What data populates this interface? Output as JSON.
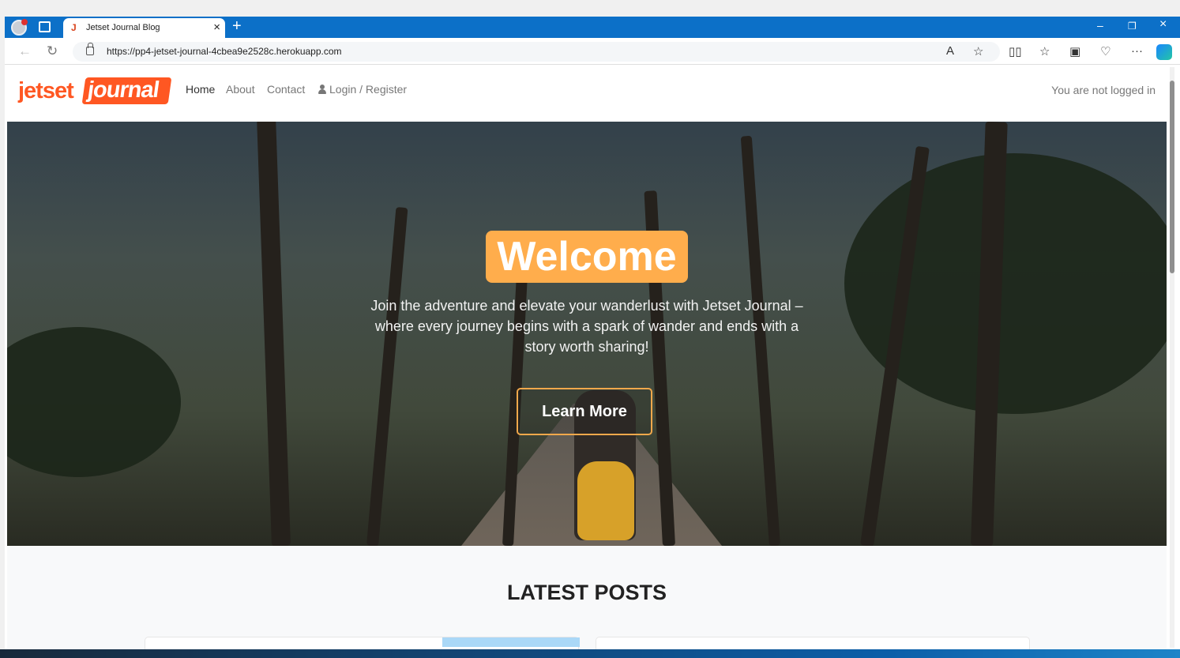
{
  "browser": {
    "tab_title": "Jetset Journal Blog",
    "tab_favicon": "J",
    "url": "https://pp4-jetset-journal-4cbea9e2528c.herokuapp.com",
    "new_tab": "+",
    "close_tab": "×",
    "minimize": "–",
    "restore": "❐",
    "close_window": "×",
    "back": "←",
    "refresh": "↻",
    "read_aloud": "A",
    "favorite": "☆",
    "split_screen": "▯▯",
    "favorites": "☆",
    "collections": "▣",
    "extensions": "♡",
    "more": "···"
  },
  "site": {
    "logo_jetset": "jetset",
    "logo_journal": "journal",
    "nav": {
      "home": "Home",
      "about": "About",
      "contact": "Contact",
      "login_register": "Login / Register"
    },
    "login_status": "You are not logged in"
  },
  "hero": {
    "title": "Welcome",
    "tagline": "Join the adventure and elevate your wanderlust with Jetset Journal – where every journey begins with a spark of wander and ends with a story worth sharing!",
    "cta": "Learn More"
  },
  "latest_posts": {
    "title": "LATEST POSTS"
  },
  "colors": {
    "browser_blue": "#0c70c8",
    "brand_orange": "#ff5722",
    "welcome_orange": "#ffad4c",
    "cta_border": "#f1a84b"
  },
  "icons": [
    "profile-icon",
    "tab-actions-icon",
    "lock-icon",
    "person-icon",
    "copilot-icon"
  ]
}
